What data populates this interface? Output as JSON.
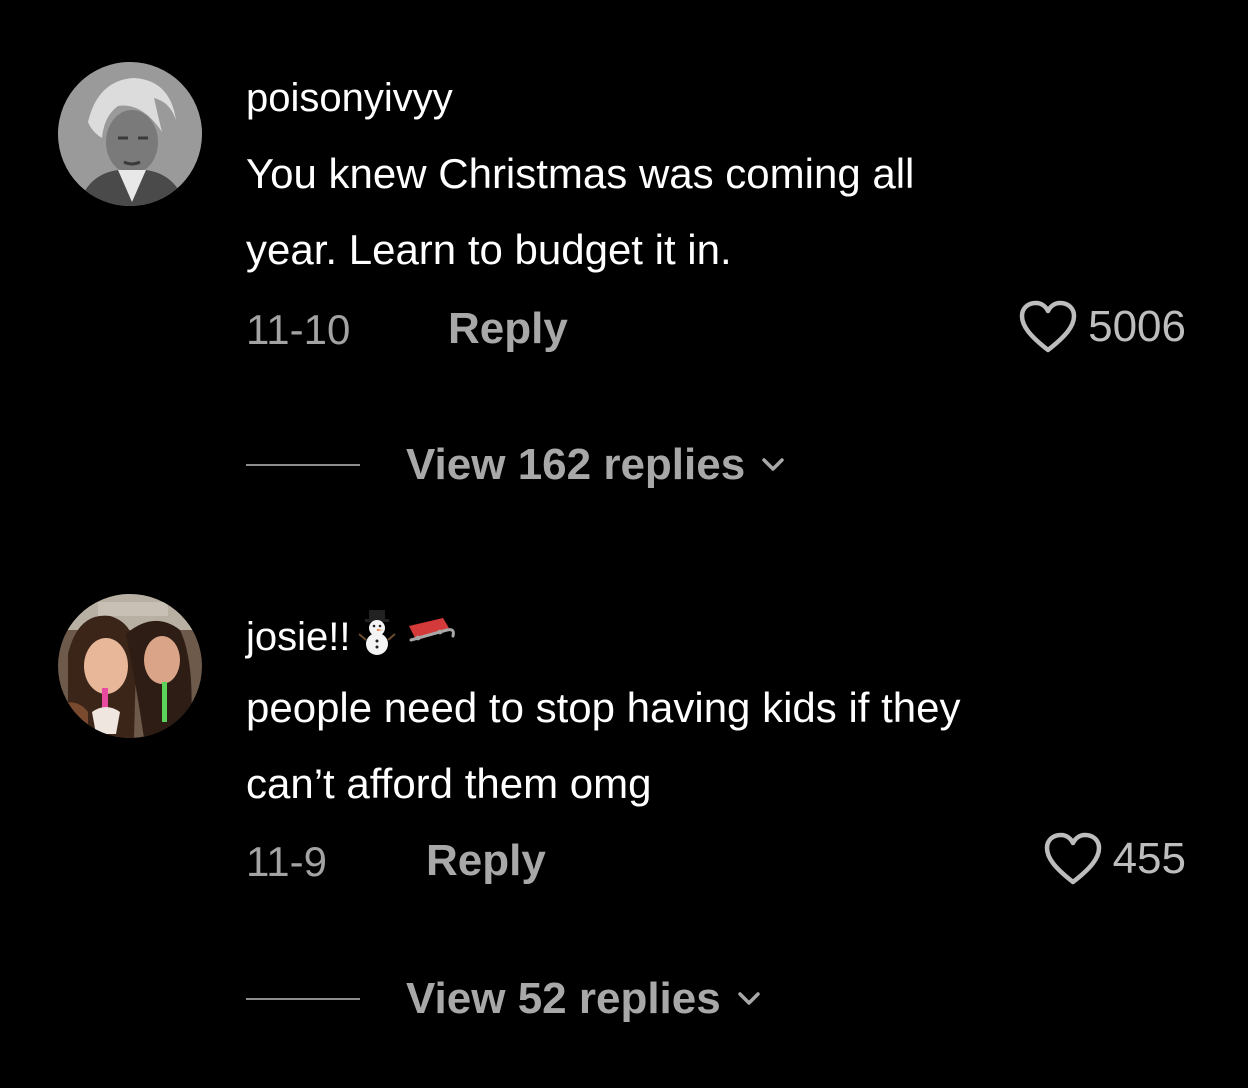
{
  "comments": [
    {
      "username": "poisonyivyy",
      "text_line1": "You knew Christmas was coming all",
      "text_line2": "year. Learn to budget it in.",
      "date": "11-10",
      "reply_label": "Reply",
      "likes": "5006",
      "view_replies": "View 162 replies",
      "avatar": "portrait-avatar"
    },
    {
      "username": "josie!!",
      "username_emoji": [
        "snowman",
        "sled"
      ],
      "text_line1": "people need to stop having kids if they",
      "text_line2": "can’t afford them omg",
      "date": "11-9",
      "reply_label": "Reply",
      "likes": "455",
      "view_replies": "View 52 replies",
      "avatar": "photo-avatar"
    }
  ],
  "colors": {
    "background": "#000000",
    "primary_text": "#ffffff",
    "secondary_text": "#a3a3a3"
  }
}
